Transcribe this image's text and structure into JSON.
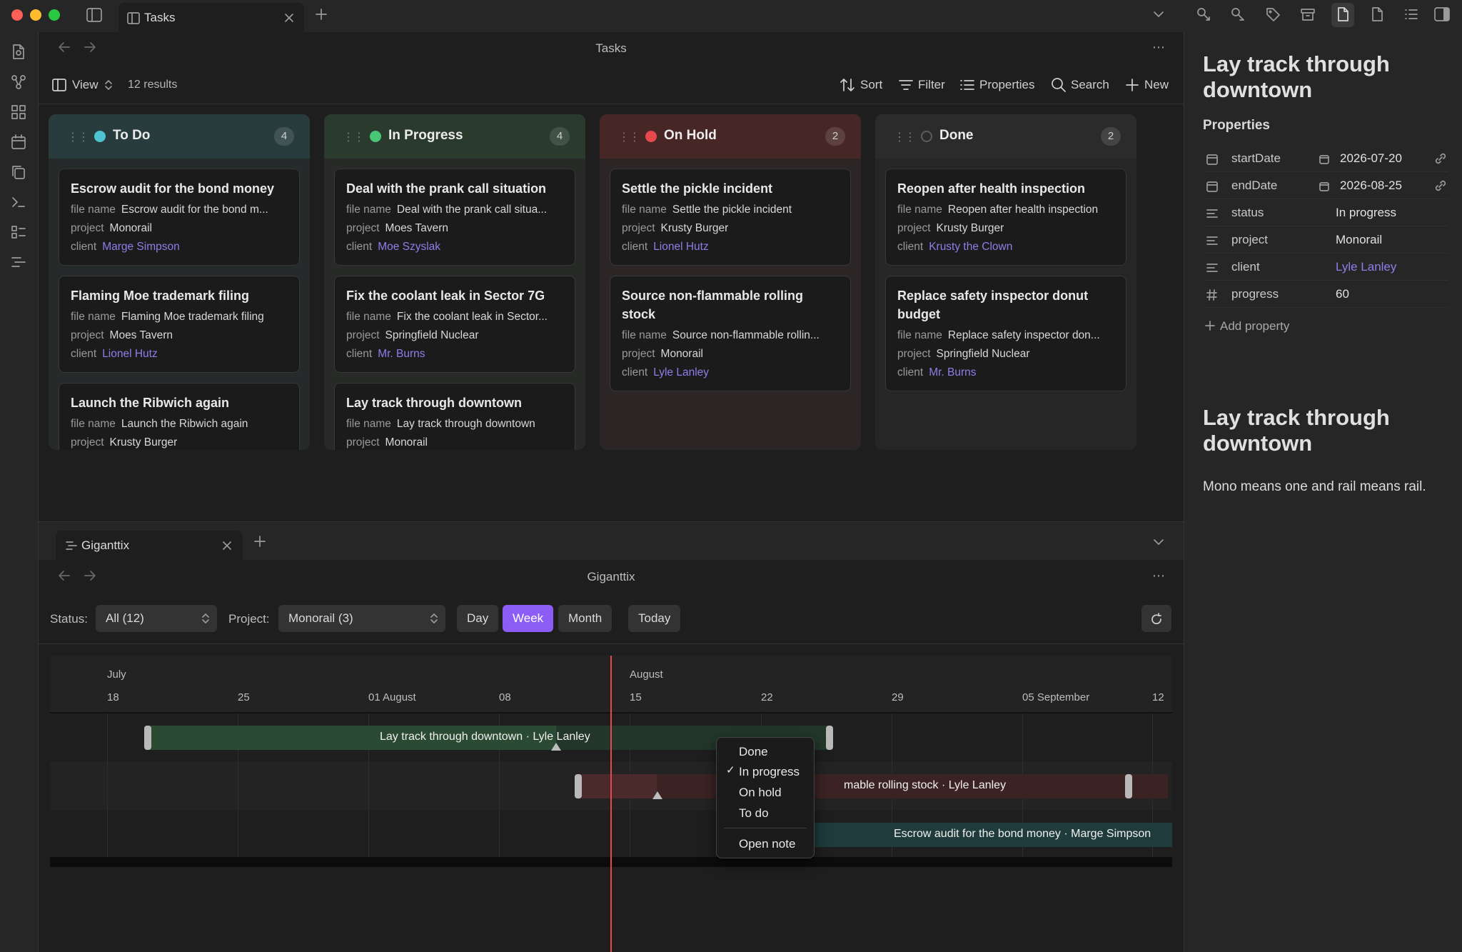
{
  "window": {
    "tab_title": "Tasks"
  },
  "tasks_view": {
    "header_title": "Tasks",
    "view_label": "View",
    "result_count": "12 results",
    "toolbar": {
      "sort": "Sort",
      "filter": "Filter",
      "properties": "Properties",
      "search": "Search",
      "new": "New"
    },
    "columns": [
      {
        "title": "To Do",
        "count": "4",
        "dot_color": "#4fc3cf",
        "head_bg": "#283c3d",
        "body_bg": "#262a2a",
        "cards": [
          {
            "title": "Escrow audit for the bond money",
            "file_name": "Escrow audit for the bond m...",
            "project": "Monorail",
            "client": "Marge Simpson"
          },
          {
            "title": "Flaming Moe trademark filing",
            "file_name": "Flaming Moe trademark filing",
            "project": "Moes Tavern",
            "client": "Lionel Hutz"
          },
          {
            "title": "Launch the Ribwich again",
            "file_name": "Launch the Ribwich again",
            "project": "Krusty Burger",
            "client": ""
          }
        ]
      },
      {
        "title": "In Progress",
        "count": "4",
        "dot_color": "#48c774",
        "head_bg": "#2a3b2d",
        "body_bg": "#272a27",
        "cards": [
          {
            "title": "Deal with the prank call situation",
            "file_name": "Deal with the prank call situa...",
            "project": "Moes Tavern",
            "client": "Moe Szyslak"
          },
          {
            "title": "Fix the coolant leak in Sector 7G",
            "file_name": "Fix the coolant leak in Sector...",
            "project": "Springfield Nuclear",
            "client": "Mr. Burns"
          },
          {
            "title": "Lay track through downtown",
            "file_name": "Lay track through downtown",
            "project": "Monorail",
            "client": ""
          }
        ]
      },
      {
        "title": "On Hold",
        "count": "2",
        "dot_color": "#e5484d",
        "head_bg": "#472626",
        "body_bg": "#2c2525",
        "cards": [
          {
            "title": "Settle the pickle incident",
            "file_name": "Settle the pickle incident",
            "project": "Krusty Burger",
            "client": "Lionel Hutz"
          },
          {
            "title": "Source non-flammable rolling stock",
            "file_name": "Source non-flammable rollin...",
            "project": "Monorail",
            "client": "Lyle Lanley"
          }
        ]
      },
      {
        "title": "Done",
        "count": "2",
        "dot_color": "",
        "head_bg": "#2b2b2b",
        "body_bg": "#262626",
        "cards": [
          {
            "title": "Reopen after health inspection",
            "file_name": "Reopen after health inspection",
            "project": "Krusty Burger",
            "client": "Krusty the Clown"
          },
          {
            "title": "Replace safety inspector donut budget",
            "file_name": "Replace safety inspector don...",
            "project": "Springfield Nuclear",
            "client": "Mr. Burns"
          }
        ]
      }
    ],
    "field_labels": {
      "file_name": "file name",
      "project": "project",
      "client": "client"
    }
  },
  "note": {
    "title": "Lay track through downtown",
    "properties_heading": "Properties",
    "properties": [
      {
        "key": "startDate",
        "value": "2026-07-20"
      },
      {
        "key": "endDate",
        "value": "2026-08-25"
      },
      {
        "key": "status",
        "value": "In progress"
      },
      {
        "key": "project",
        "value": "Monorail"
      },
      {
        "key": "client",
        "value": "Lyle Lanley"
      },
      {
        "key": "progress",
        "value": "60"
      }
    ],
    "add_property": "Add property",
    "body_title": "Lay track through downtown",
    "body_text": "Mono means one and rail means rail."
  },
  "gantt": {
    "tab_title": "Giganttix",
    "header_title": "Giganttix",
    "status_label": "Status:",
    "status_value": "All (12)",
    "project_label": "Project:",
    "project_value": "Monorail (3)",
    "scale_buttons": [
      "Day",
      "Week",
      "Month"
    ],
    "active_scale": "Week",
    "today_button": "Today",
    "months": [
      "July",
      "August"
    ],
    "week_ticks": [
      "18",
      "25",
      "01 August",
      "08",
      "15",
      "22",
      "29",
      "05 September",
      "12"
    ],
    "bars": [
      {
        "label": "Lay track through downtown · Lyle Lanley",
        "progress": 0.6
      },
      {
        "label": "mable rolling stock · Lyle Lanley"
      },
      {
        "label": "Escrow audit for the bond money · Marge Simpson"
      }
    ],
    "context_menu": {
      "items": [
        "Done",
        "In progress",
        "On hold",
        "To do"
      ],
      "checked": "In progress",
      "open_note": "Open note"
    },
    "accent": "#8b5cf6",
    "today_line_color": "#e5484d"
  }
}
